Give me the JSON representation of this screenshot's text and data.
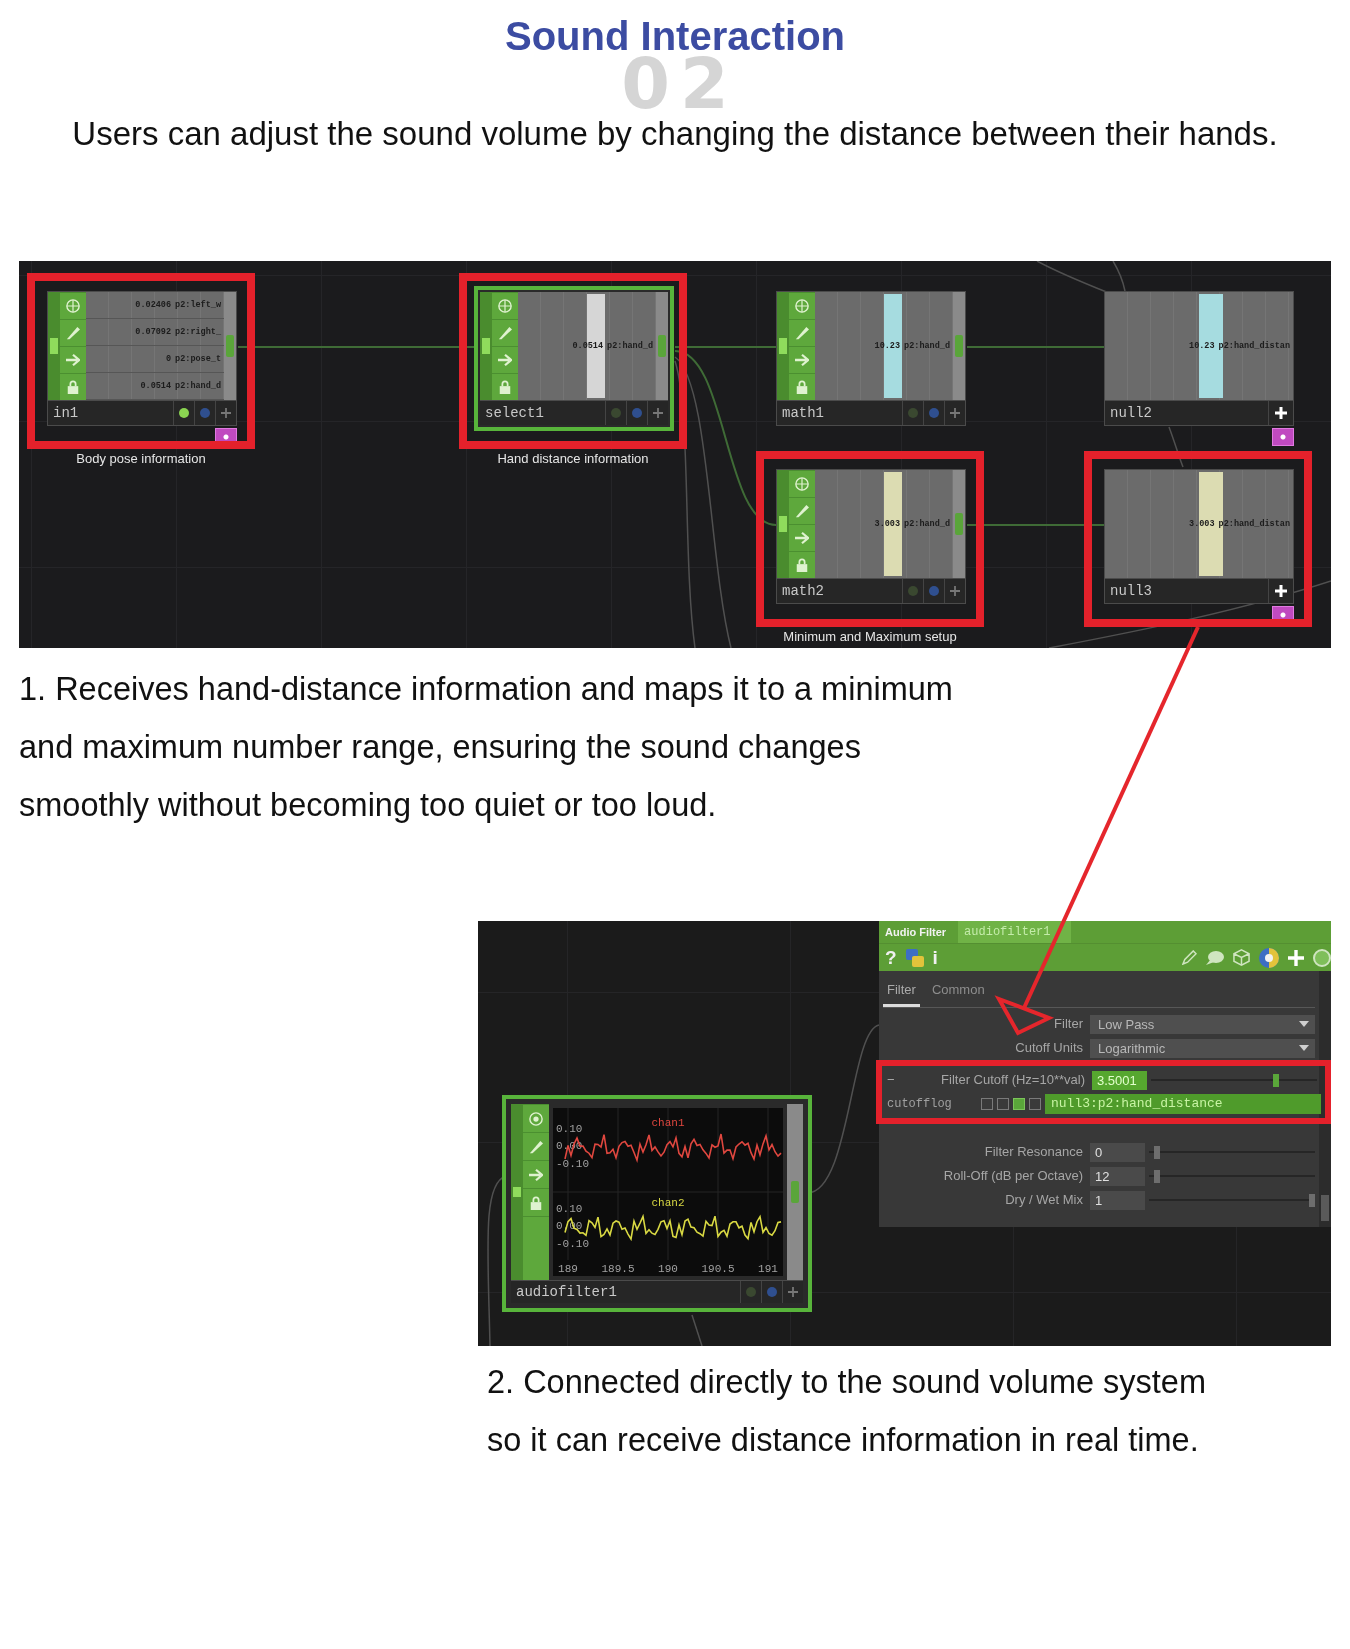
{
  "header": {
    "section_number": "02",
    "title": "Sound Interaction",
    "subtitle": "Users can adjust the sound volume by changing the distance between their hands."
  },
  "node_network": {
    "nodes": [
      {
        "kind": "operator",
        "name": "in1",
        "selected": false,
        "display": true,
        "highlighted": true,
        "marker": true,
        "caption": "Body pose information",
        "channels": [
          {
            "value": "0.02406",
            "name": "p2:left_w"
          },
          {
            "value": "0.07092",
            "name": "p2:right_"
          },
          {
            "value": "0",
            "name": "p2:pose_t"
          },
          {
            "value": "0.0514",
            "name": "p2:hand_d"
          }
        ]
      },
      {
        "kind": "operator",
        "name": "select1",
        "selected": true,
        "display": false,
        "highlighted": true,
        "marker": false,
        "caption": "Hand distance information",
        "color": "#d6d6d6",
        "channels": [
          {
            "value": "0.0514",
            "name": "p2:hand_d"
          }
        ]
      },
      {
        "kind": "operator",
        "name": "math1",
        "selected": false,
        "display": false,
        "highlighted": false,
        "marker": false,
        "color": "#a6dce0",
        "channels": [
          {
            "value": "10.23",
            "name": "p2:hand_d"
          }
        ]
      },
      {
        "kind": "null",
        "name": "null2",
        "selected": false,
        "highlighted": false,
        "marker": true,
        "color": "#a6dce0",
        "channels": [
          {
            "value": "10.23",
            "name": "p2:hand_distan"
          }
        ]
      },
      {
        "kind": "operator",
        "name": "math2",
        "selected": false,
        "display": false,
        "highlighted": true,
        "marker": false,
        "caption": "Minimum and Maximum setup",
        "color": "#dcdcb2",
        "channels": [
          {
            "value": "3.003",
            "name": "p2:hand_d"
          }
        ]
      },
      {
        "kind": "null",
        "name": "null3",
        "selected": false,
        "highlighted": true,
        "marker": true,
        "color": "#dcdcb2",
        "channels": [
          {
            "value": "3.003",
            "name": "p2:hand_distan"
          }
        ]
      }
    ]
  },
  "description_1": {
    "lines": [
      "1. Receives hand-distance information and maps it to a minimum",
      "and maximum number range, ensuring the sound changes",
      "smoothly without becoming too quiet or too loud."
    ]
  },
  "audio_filter": {
    "node": {
      "name": "audiofilter1",
      "selected": true,
      "display": false,
      "channels": [
        {
          "name": "chan1",
          "color": "#e0473f",
          "labels": [
            "0.10",
            "0.00",
            "-0.10"
          ]
        },
        {
          "name": "chan2",
          "color": "#d9d943",
          "labels": [
            "0.10",
            "0.00",
            "-0.10"
          ]
        }
      ],
      "x_ticks": [
        "189",
        "189.5",
        "190",
        "190.5",
        "191"
      ]
    },
    "panel": {
      "title": "Audio Filter",
      "name": "audiofilter1",
      "toolbar": {
        "help": "?",
        "info": "i"
      },
      "tabs": [
        {
          "label": "Filter",
          "selected": true
        },
        {
          "label": "Common",
          "selected": false
        }
      ],
      "parameter_groups": [
        {
          "highlighted": false,
          "parameters": [
            {
              "kind": "menu",
              "label": "Filter",
              "value": "Low Pass"
            },
            {
              "kind": "menu",
              "label": "Cutoff Units",
              "value": "Logarithmic"
            }
          ]
        },
        {
          "highlighted": true,
          "parameters": [
            {
              "kind": "slider",
              "toggle": "−",
              "label": "Filter Cutoff (Hz=10**val)",
              "value": "3.5001",
              "linked": true,
              "level": 0.76
            },
            {
              "kind": "reference",
              "label": "cutofflog",
              "modes": [
                {
                  "selected": false
                },
                {
                  "selected": false
                },
                {
                  "selected": true
                },
                {
                  "selected": false
                }
              ],
              "value": "null3:p2:hand_distance"
            }
          ]
        },
        {
          "highlighted": false,
          "parameters": [
            {
              "kind": "slider",
              "label": "Filter Resonance",
              "value": "0",
              "linked": false,
              "level": 0.03
            },
            {
              "kind": "slider",
              "label": "Roll-Off (dB per Octave)",
              "value": "12",
              "linked": false,
              "level": 0.03
            },
            {
              "kind": "slider",
              "label": "Dry / Wet Mix",
              "value": "1",
              "linked": false,
              "level": 1
            }
          ]
        }
      ]
    }
  },
  "description_2": {
    "lines": [
      "2. Connected directly to the sound volume system",
      "so it can receive distance information in real time."
    ]
  }
}
